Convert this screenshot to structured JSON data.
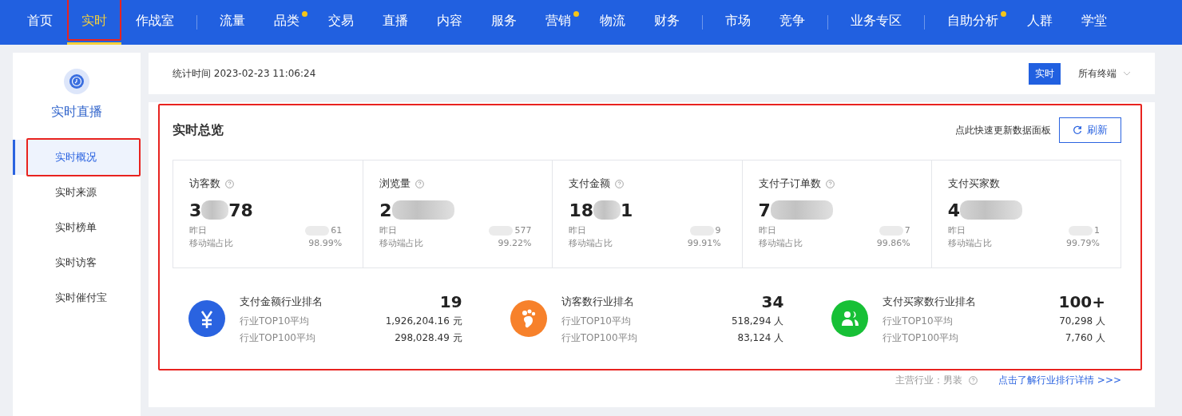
{
  "nav": {
    "groups": [
      [
        {
          "label": "首页",
          "selected": false,
          "dot": false,
          "highlighted": false
        },
        {
          "label": "实时",
          "selected": true,
          "dot": false,
          "highlighted": true
        },
        {
          "label": "作战室",
          "selected": false,
          "dot": false,
          "highlighted": false
        }
      ],
      [
        {
          "label": "流量",
          "selected": false,
          "dot": false,
          "highlighted": false
        },
        {
          "label": "品类",
          "selected": false,
          "dot": true,
          "highlighted": false
        },
        {
          "label": "交易",
          "selected": false,
          "dot": false,
          "highlighted": false
        },
        {
          "label": "直播",
          "selected": false,
          "dot": false,
          "highlighted": false
        },
        {
          "label": "内容",
          "selected": false,
          "dot": false,
          "highlighted": false
        },
        {
          "label": "服务",
          "selected": false,
          "dot": false,
          "highlighted": false
        },
        {
          "label": "营销",
          "selected": false,
          "dot": true,
          "highlighted": false
        },
        {
          "label": "物流",
          "selected": false,
          "dot": false,
          "highlighted": false
        },
        {
          "label": "财务",
          "selected": false,
          "dot": false,
          "highlighted": false
        }
      ],
      [
        {
          "label": "市场",
          "selected": false,
          "dot": false,
          "highlighted": false
        },
        {
          "label": "竞争",
          "selected": false,
          "dot": false,
          "highlighted": false
        }
      ],
      [
        {
          "label": "业务专区",
          "selected": false,
          "dot": false,
          "highlighted": false
        }
      ],
      [
        {
          "label": "自助分析",
          "selected": false,
          "dot": true,
          "highlighted": false
        },
        {
          "label": "人群",
          "selected": false,
          "dot": false,
          "highlighted": false
        },
        {
          "label": "学堂",
          "selected": false,
          "dot": false,
          "highlighted": false
        }
      ]
    ]
  },
  "sidebar": {
    "title": "实时直播",
    "items": [
      {
        "label": "实时概况",
        "selected": true,
        "highlighted": true
      },
      {
        "label": "实时来源",
        "selected": false,
        "highlighted": false
      },
      {
        "label": "实时榜单",
        "selected": false,
        "highlighted": false
      },
      {
        "label": "实时访客",
        "selected": false,
        "highlighted": false
      },
      {
        "label": "实时催付宝",
        "selected": false,
        "highlighted": false
      }
    ]
  },
  "header": {
    "stat_time": "统计时间 2023-02-23 11:06:24",
    "mode_button": "实时",
    "terminal_select": "所有终端"
  },
  "overview": {
    "title": "实时总览",
    "highlighted": true,
    "refresh_hint": "点此快速更新数据面板",
    "refresh_button": "刷新",
    "metrics": [
      {
        "label": "访客数",
        "help": true,
        "value_start": "3",
        "value_end": "78",
        "yesterday_label": "昨日",
        "yesterday_value": "61",
        "mobile_label": "移动端占比",
        "mobile_value": "98.99%"
      },
      {
        "label": "浏览量",
        "help": true,
        "value_start": "2",
        "yesterday_label": "昨日",
        "yesterday_value": "577",
        "mobile_label": "移动端占比",
        "mobile_value": "99.22%"
      },
      {
        "label": "支付金额",
        "help": true,
        "value_start": "18",
        "value_end": "1",
        "yesterday_label": "昨日",
        "yesterday_value": "9",
        "mobile_label": "移动端占比",
        "mobile_value": "99.91%"
      },
      {
        "label": "支付子订单数",
        "help": true,
        "value_start": "7",
        "yesterday_label": "昨日",
        "yesterday_value": "7",
        "mobile_label": "移动端占比",
        "mobile_value": "99.86%"
      },
      {
        "label": "支付买家数",
        "help": false,
        "value_start": "4",
        "yesterday_label": "昨日",
        "yesterday_value": "1",
        "mobile_label": "移动端占比",
        "mobile_value": "99.79%"
      }
    ],
    "rankings": [
      {
        "kind": "money",
        "color": "#2a63e0",
        "title": "支付金额行业排名",
        "rank": "19",
        "rows": [
          {
            "label": "行业TOP10平均",
            "value": "1,926,204.16 元"
          },
          {
            "label": "行业TOP100平均",
            "value": "298,028.49 元"
          }
        ]
      },
      {
        "kind": "visitor",
        "color": "#f7812b",
        "title": "访客数行业排名",
        "rank": "34",
        "rows": [
          {
            "label": "行业TOP10平均",
            "value": "518,294 人"
          },
          {
            "label": "行业TOP100平均",
            "value": "83,124 人"
          }
        ]
      },
      {
        "kind": "buyer",
        "color": "#17c036",
        "title": "支付买家数行业排名",
        "rank": "100+",
        "rows": [
          {
            "label": "行业TOP10平均",
            "value": "70,298 人"
          },
          {
            "label": "行业TOP100平均",
            "value": "7,760 人"
          }
        ]
      }
    ],
    "industry": "主营行业：男装",
    "industry_link": "点击了解行业排行详情 >>>"
  }
}
